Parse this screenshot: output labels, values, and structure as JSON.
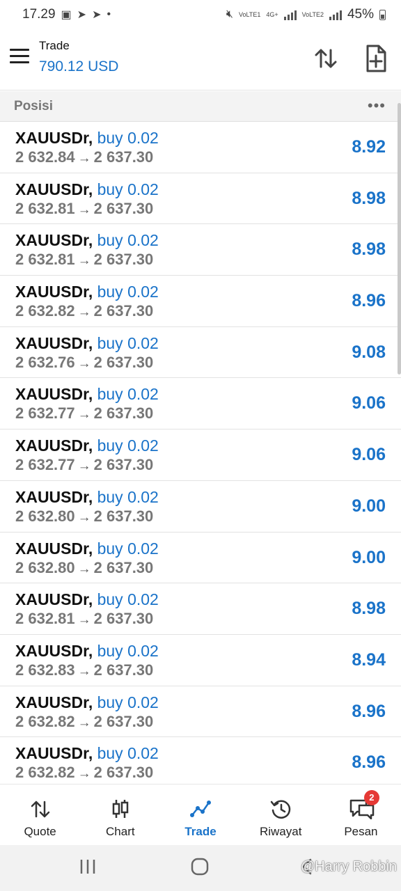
{
  "status_bar": {
    "time": "17.29",
    "sim1_label": "VoLTE1",
    "network_label": "4G+",
    "sim2_label": "VoLTE2",
    "battery": "45%"
  },
  "header": {
    "title": "Trade",
    "balance": "790.12 USD"
  },
  "section": {
    "title": "Posisi",
    "more": "•••"
  },
  "positions": [
    {
      "symbol": "XAUUSDr",
      "side": "buy 0.02",
      "open_price": "2 632.84",
      "current_price": "2 637.30",
      "profit": "8.92"
    },
    {
      "symbol": "XAUUSDr",
      "side": "buy 0.02",
      "open_price": "2 632.81",
      "current_price": "2 637.30",
      "profit": "8.98"
    },
    {
      "symbol": "XAUUSDr",
      "side": "buy 0.02",
      "open_price": "2 632.81",
      "current_price": "2 637.30",
      "profit": "8.98"
    },
    {
      "symbol": "XAUUSDr",
      "side": "buy 0.02",
      "open_price": "2 632.82",
      "current_price": "2 637.30",
      "profit": "8.96"
    },
    {
      "symbol": "XAUUSDr",
      "side": "buy 0.02",
      "open_price": "2 632.76",
      "current_price": "2 637.30",
      "profit": "9.08"
    },
    {
      "symbol": "XAUUSDr",
      "side": "buy 0.02",
      "open_price": "2 632.77",
      "current_price": "2 637.30",
      "profit": "9.06"
    },
    {
      "symbol": "XAUUSDr",
      "side": "buy 0.02",
      "open_price": "2 632.77",
      "current_price": "2 637.30",
      "profit": "9.06"
    },
    {
      "symbol": "XAUUSDr",
      "side": "buy 0.02",
      "open_price": "2 632.80",
      "current_price": "2 637.30",
      "profit": "9.00"
    },
    {
      "symbol": "XAUUSDr",
      "side": "buy 0.02",
      "open_price": "2 632.80",
      "current_price": "2 637.30",
      "profit": "9.00"
    },
    {
      "symbol": "XAUUSDr",
      "side": "buy 0.02",
      "open_price": "2 632.81",
      "current_price": "2 637.30",
      "profit": "8.98"
    },
    {
      "symbol": "XAUUSDr",
      "side": "buy 0.02",
      "open_price": "2 632.83",
      "current_price": "2 637.30",
      "profit": "8.94"
    },
    {
      "symbol": "XAUUSDr",
      "side": "buy 0.02",
      "open_price": "2 632.82",
      "current_price": "2 637.30",
      "profit": "8.96"
    },
    {
      "symbol": "XAUUSDr",
      "side": "buy 0.02",
      "open_price": "2 632.82",
      "current_price": "2 637.30",
      "profit": "8.96"
    }
  ],
  "bottom_nav": [
    {
      "label": "Quote",
      "icon": "quote-arrows-icon"
    },
    {
      "label": "Chart",
      "icon": "candlestick-icon"
    },
    {
      "label": "Trade",
      "icon": "trade-line-icon",
      "active": true
    },
    {
      "label": "Riwayat",
      "icon": "history-icon"
    },
    {
      "label": "Pesan",
      "icon": "chat-icon",
      "badge": "2"
    }
  ],
  "watermark": "@Harry Robbin",
  "colors": {
    "accent": "#1a73c9",
    "badge": "#e53935"
  }
}
